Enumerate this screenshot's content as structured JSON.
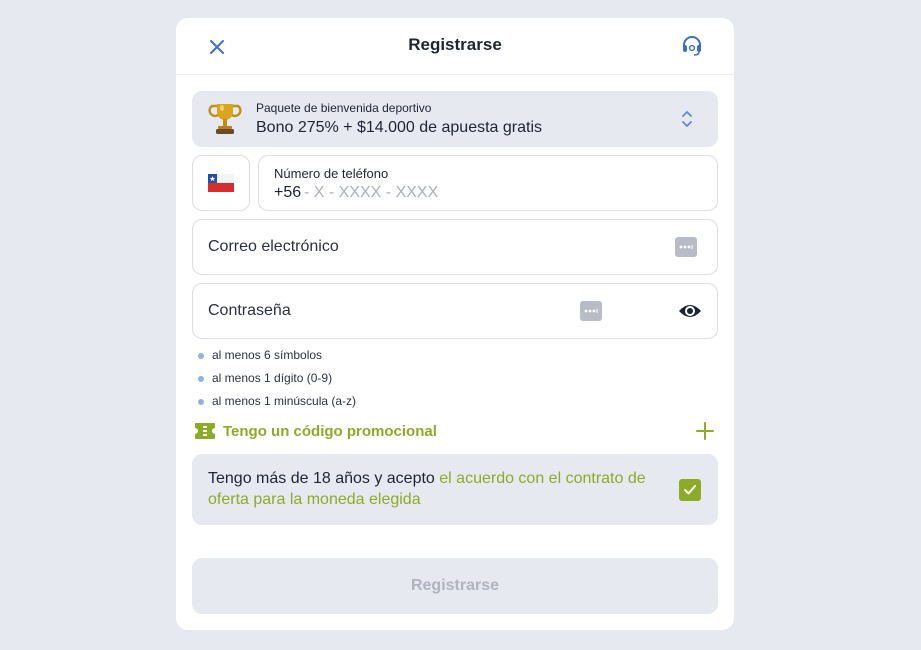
{
  "header": {
    "title": "Registrarse"
  },
  "bonus": {
    "label": "Paquete de bienvenida deportivo",
    "value": "Bono 275% + $14.000 de apuesta gratis"
  },
  "phone": {
    "country": "Chile",
    "label": "Número de teléfono",
    "prefix": "+56",
    "mask": "- X - XXXX - XXXX"
  },
  "email": {
    "placeholder": "Correo electrónico"
  },
  "password": {
    "placeholder": "Contraseña",
    "rules": [
      "al menos 6 símbolos",
      "al menos 1 dígito (0-9)",
      "al menos 1 minúscula (a-z)"
    ]
  },
  "promo": {
    "label": "Tengo un código promocional"
  },
  "agreement": {
    "text_before": "Tengo más de 18 años y acepto ",
    "link_text": "el acuerdo con el contrato de oferta para la moneda elegida",
    "checked": true
  },
  "submit": {
    "label": "Registrarse"
  },
  "colors": {
    "accent": "#8cab27",
    "link_blue": "#3a6fc4",
    "background": "#e6e9f0"
  },
  "icons": {
    "close": "close-icon",
    "support": "headset-icon",
    "bonus": "trophy-icon",
    "select": "chevron-updown-icon",
    "flag": "chile-flag-icon",
    "autofill": "key-icon",
    "visibility": "eye-icon",
    "promo": "ticket-icon",
    "expand": "plus-icon",
    "check": "check-icon"
  }
}
